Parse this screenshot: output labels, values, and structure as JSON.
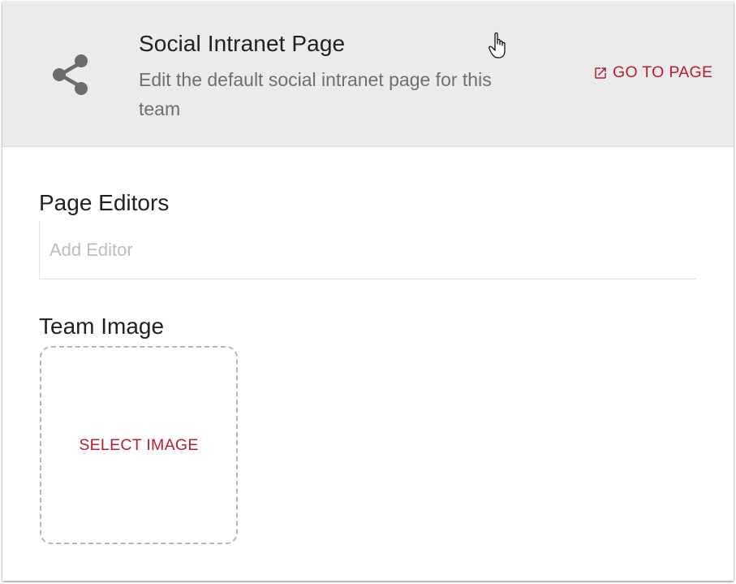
{
  "header": {
    "title": "Social Intranet Page",
    "description": "Edit the default social intranet page for this team",
    "goto_label": "GO TO PAGE",
    "icon": "share-icon",
    "link_icon": "external-link-icon"
  },
  "editors": {
    "label": "Page Editors",
    "placeholder": "Add Editor",
    "value": ""
  },
  "team_image": {
    "label": "Team Image",
    "select_label": "SELECT IMAGE"
  },
  "colors": {
    "accent": "#b81c2e",
    "header_bg": "#ebebeb",
    "icon_gray": "#6b6b6b"
  }
}
